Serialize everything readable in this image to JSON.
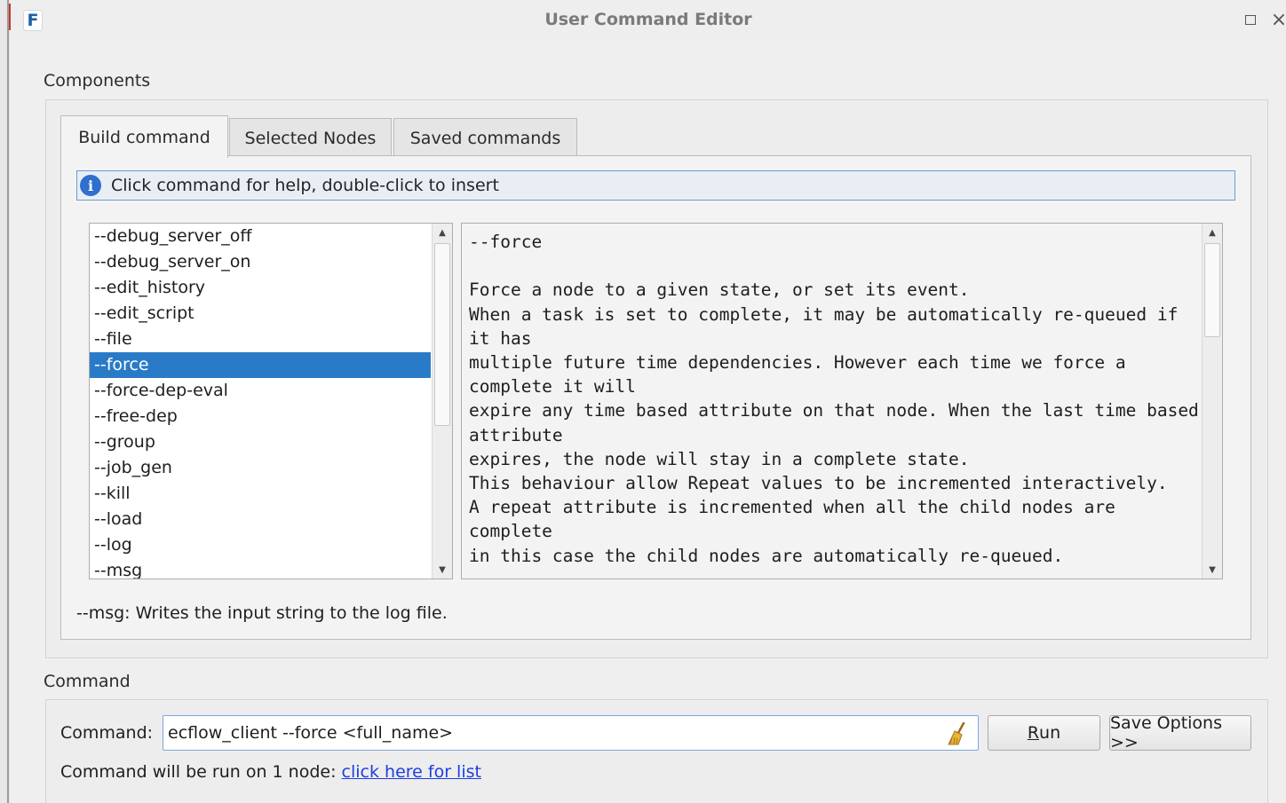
{
  "window": {
    "title": "User Command Editor",
    "app_icon_letter": "F"
  },
  "components": {
    "label": "Components",
    "tabs": [
      {
        "label": "Build command",
        "active": true
      },
      {
        "label": "Selected Nodes",
        "active": false
      },
      {
        "label": "Saved commands",
        "active": false
      }
    ],
    "info_banner": "Click command for help, double-click to insert",
    "command_list": [
      "--debug_server_off",
      "--debug_server_on",
      "--edit_history",
      "--edit_script",
      "--file",
      "--force",
      "--force-dep-eval",
      "--free-dep",
      "--group",
      "--job_gen",
      "--kill",
      "--load",
      "--log",
      "--msg"
    ],
    "selected_command": "--force",
    "help_text": "--force\n\nForce a node to a given state, or set its event.\nWhen a task is set to complete, it may be automatically re-queued if it has\nmultiple future time dependencies. However each time we force a complete it will\nexpire any time based attribute on that node. When the last time based attribute\nexpires, the node will stay in a complete state.\nThis behaviour allow Repeat values to be incremented interactively.\nA repeat attribute is incremented when all the child nodes are complete\nin this case the child nodes are automatically re-queued.",
    "hover_description": "--msg: Writes the input string to the log file."
  },
  "command": {
    "section_label": "Command",
    "field_label": "Command:",
    "value": "ecflow_client --force  <full_name>",
    "run_label_prefix": "",
    "run_label_underlined": "R",
    "run_label_rest": "un",
    "save_options_label": "Save Options >>",
    "run_on_text": "Command will be run on 1 node: ",
    "run_on_link": "click here for list"
  }
}
